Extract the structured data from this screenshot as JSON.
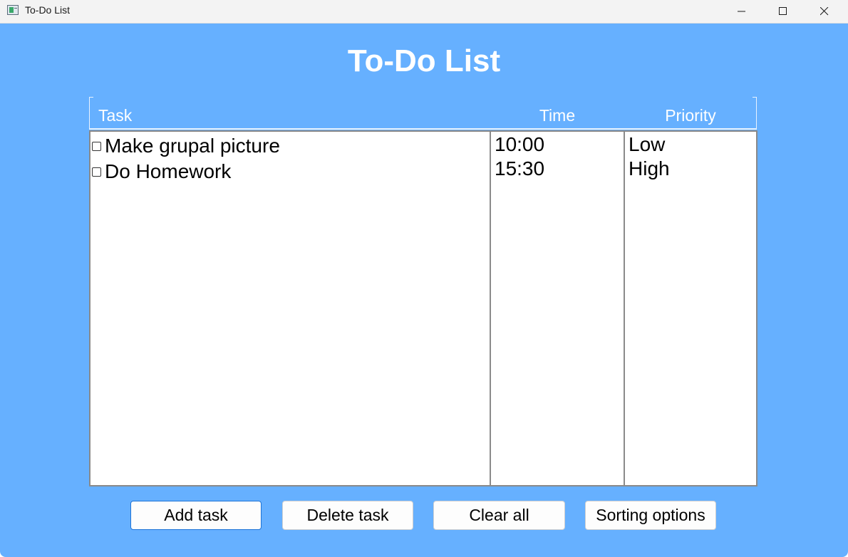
{
  "window": {
    "title": "To-Do List",
    "icon": "app-window-icon",
    "controls": [
      "minimize-icon",
      "maximize-icon",
      "close-icon"
    ]
  },
  "colors": {
    "background": "#66b0ff",
    "title_text": "#ffffff",
    "focus_border": "#1e73d6"
  },
  "page": {
    "title": "To-Do List"
  },
  "table": {
    "headers": {
      "task": "Task",
      "time": "Time",
      "priority": "Priority"
    },
    "rows": [
      {
        "task": "Make grupal picture",
        "time": "10:00",
        "priority": "Low",
        "checked": false
      },
      {
        "task": "Do Homework",
        "time": "15:30",
        "priority": "High",
        "checked": false
      }
    ]
  },
  "buttons": {
    "add": "Add task",
    "delete": "Delete task",
    "clear": "Clear all",
    "sort": "Sorting options"
  }
}
